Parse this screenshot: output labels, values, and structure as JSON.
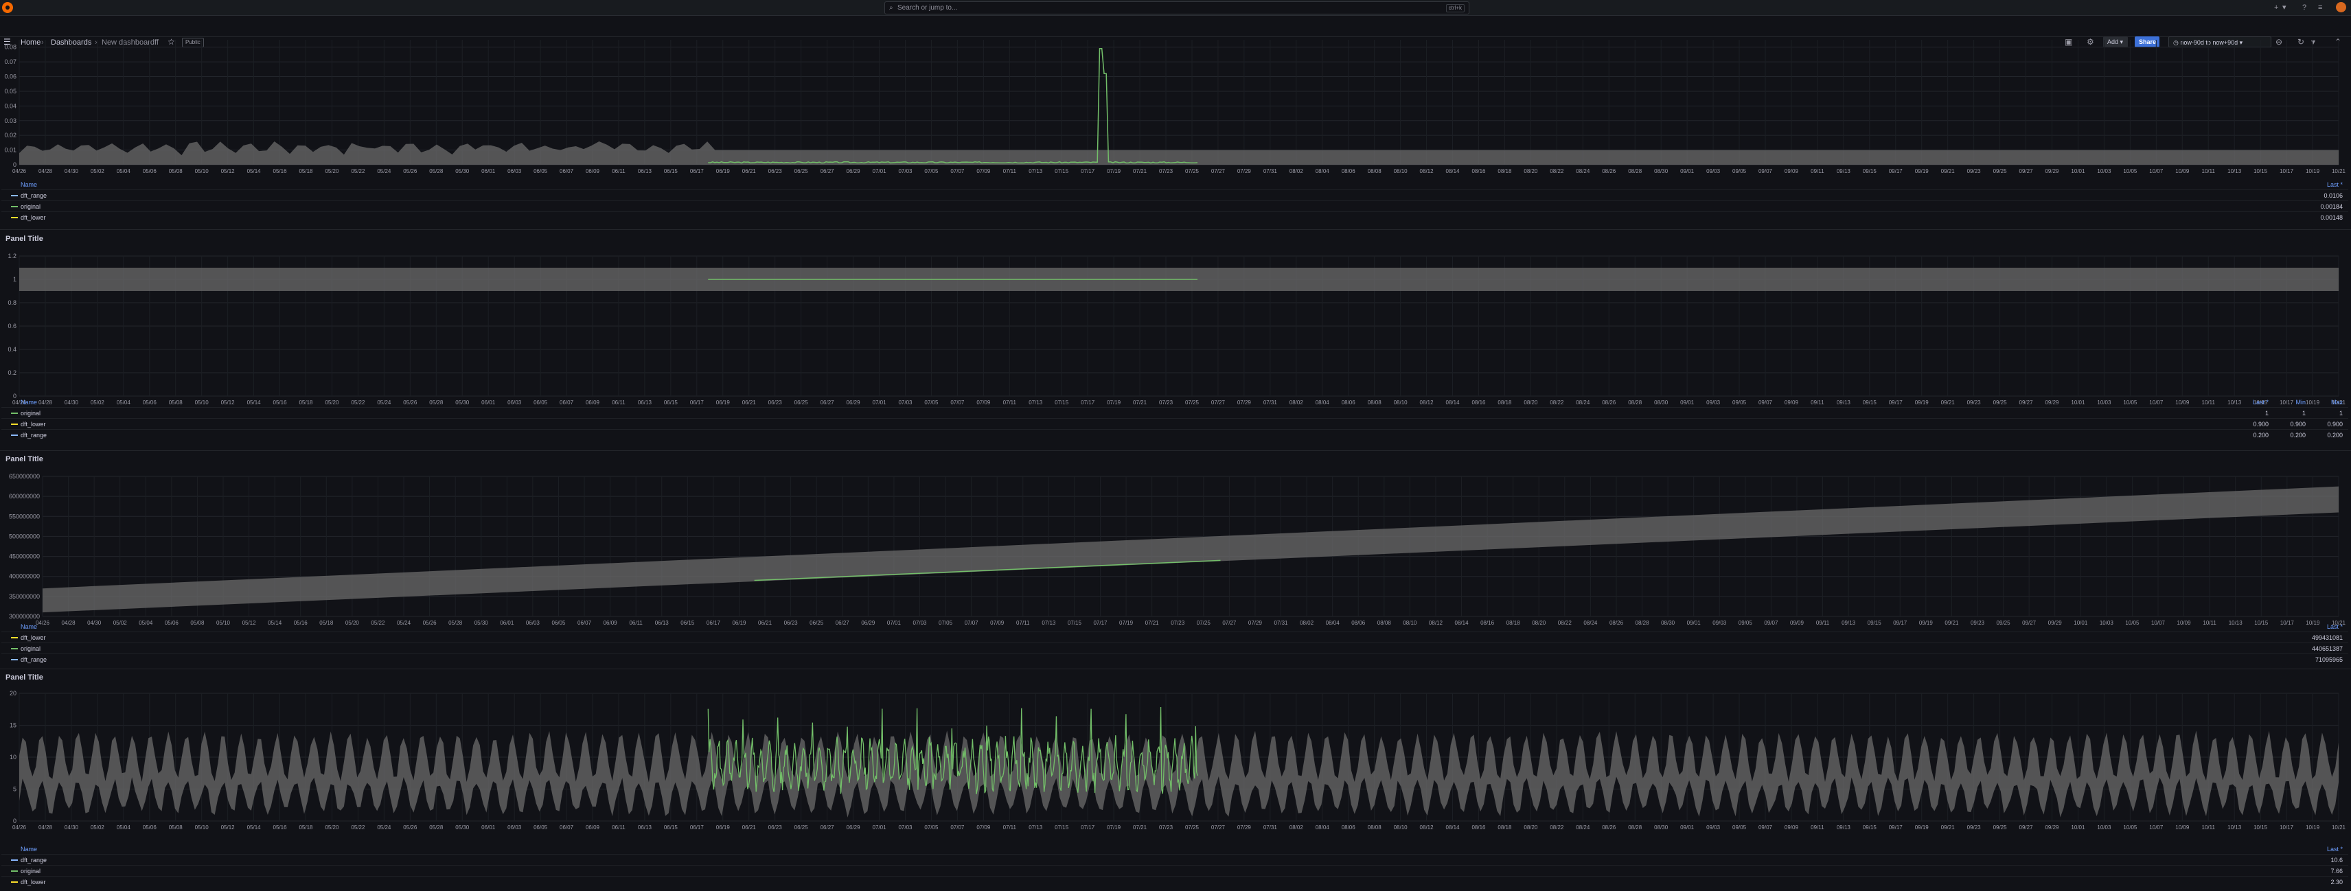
{
  "topbar": {
    "search_placeholder": "Search or jump to...",
    "search_shortcut": "ctrl+k",
    "icons": [
      "grafana-logo",
      "search-icon",
      "plus-icon",
      "help-icon",
      "news-icon",
      "user-avatar"
    ]
  },
  "navbar": {
    "breadcrumb": [
      "Home",
      "Dashboards",
      "New dashboardff"
    ],
    "public_badge": "Public",
    "add_label": "Add",
    "share_label": "Share",
    "time_range": "now-90d to now+90d"
  },
  "colors": {
    "background": "#111217",
    "band": "#6b6b6b",
    "original": "#73bf69",
    "dft_lower": "#fade2a",
    "dft_range": "#8ab8ff",
    "legend_header": "#6e9fff"
  },
  "x_ticks": [
    "04/26",
    "04/28",
    "04/30",
    "05/02",
    "05/04",
    "05/06",
    "05/08",
    "05/10",
    "05/12",
    "05/14",
    "05/16",
    "05/18",
    "05/20",
    "05/22",
    "05/24",
    "05/26",
    "05/28",
    "05/30",
    "06/01",
    "06/03",
    "06/05",
    "06/07",
    "06/09",
    "06/11",
    "06/13",
    "06/15",
    "06/17",
    "06/19",
    "06/21",
    "06/23",
    "06/25",
    "06/27",
    "06/29",
    "07/01",
    "07/03",
    "07/05",
    "07/07",
    "07/09",
    "07/11",
    "07/13",
    "07/15",
    "07/17",
    "07/19",
    "07/21",
    "07/23",
    "07/25",
    "07/27",
    "07/29",
    "07/31",
    "08/02",
    "08/04",
    "08/06",
    "08/08",
    "08/10",
    "08/12",
    "08/14",
    "08/16",
    "08/18",
    "08/20",
    "08/22",
    "08/24",
    "08/26",
    "08/28",
    "08/30",
    "09/01",
    "09/03",
    "09/05",
    "09/07",
    "09/09",
    "09/11",
    "09/13",
    "09/15",
    "09/17",
    "09/19",
    "09/21",
    "09/23",
    "09/25",
    "09/27",
    "09/29",
    "10/01",
    "10/03",
    "10/05",
    "10/07",
    "10/09",
    "10/11",
    "10/13",
    "10/15",
    "10/17",
    "10/19",
    "10/21"
  ],
  "panels": [
    {
      "title": "",
      "y_ticks": [
        "0.08",
        "0.07",
        "0.06",
        "0.05",
        "0.04",
        "0.03",
        "0.02",
        "0.01",
        "0"
      ],
      "legend_header": {
        "name": "Name",
        "cols": [
          "Last *"
        ]
      },
      "legend": [
        {
          "name": "dft_range",
          "color_key": "dft_range",
          "values": [
            "0.0106"
          ]
        },
        {
          "name": "original",
          "color_key": "original",
          "values": [
            "0.00184"
          ]
        },
        {
          "name": "dft_lower",
          "color_key": "dft_lower",
          "values": [
            "0.00148"
          ]
        }
      ],
      "chart_data": {
        "type": "line",
        "series": [
          "dft_range",
          "original",
          "dft_lower"
        ],
        "band_y": [
          0.0,
          0.01
        ],
        "original_spike_peak": 0.079
      }
    },
    {
      "title": "Panel Title",
      "y_ticks": [
        "1.2",
        "1",
        "0.8",
        "0.6",
        "0.4",
        "0.2",
        "0"
      ],
      "legend_header": {
        "name": "Name",
        "cols": [
          "Last *",
          "Min",
          "Max"
        ]
      },
      "legend": [
        {
          "name": "original",
          "color_key": "original",
          "values": [
            "1",
            "1",
            "1"
          ]
        },
        {
          "name": "dft_lower",
          "color_key": "dft_lower",
          "values": [
            "0.900",
            "0.900",
            "0.900"
          ]
        },
        {
          "name": "dft_range",
          "color_key": "dft_range",
          "values": [
            "0.200",
            "0.200",
            "0.200"
          ]
        }
      ],
      "chart_data": {
        "type": "line",
        "band_y": [
          0.9,
          1.1
        ],
        "original_value": 1
      }
    },
    {
      "title": "Panel Title",
      "y_ticks": [
        "650000000",
        "600000000",
        "550000000",
        "500000000",
        "450000000",
        "400000000",
        "350000000",
        "300000000"
      ],
      "legend_header": {
        "name": "Name",
        "cols": [
          "Last *"
        ]
      },
      "legend": [
        {
          "name": "dft_lower",
          "color_key": "dft_lower",
          "values": [
            "499431081"
          ]
        },
        {
          "name": "original",
          "color_key": "original",
          "values": [
            "440651387"
          ]
        },
        {
          "name": "dft_range",
          "color_key": "dft_range",
          "values": [
            "71095965"
          ]
        }
      ],
      "chart_data": {
        "type": "line",
        "band_start": [
          310000000,
          370000000
        ],
        "band_end": [
          560000000,
          625000000
        ],
        "original_range": [
          390000000,
          440000000
        ]
      }
    },
    {
      "title": "Panel Title",
      "y_ticks": [
        "20",
        "15",
        "10",
        "5",
        "0"
      ],
      "legend_header": {
        "name": "Name",
        "cols": [
          "Last *"
        ]
      },
      "legend": [
        {
          "name": "dft_range",
          "color_key": "dft_range",
          "values": [
            "10.6"
          ]
        },
        {
          "name": "original",
          "color_key": "original",
          "values": [
            "7.66"
          ]
        },
        {
          "name": "dft_lower",
          "color_key": "dft_lower",
          "values": [
            "2.30"
          ]
        }
      ],
      "chart_data": {
        "type": "line",
        "band_y_approx": [
          2,
          14
        ],
        "original_peak": 19
      }
    }
  ]
}
